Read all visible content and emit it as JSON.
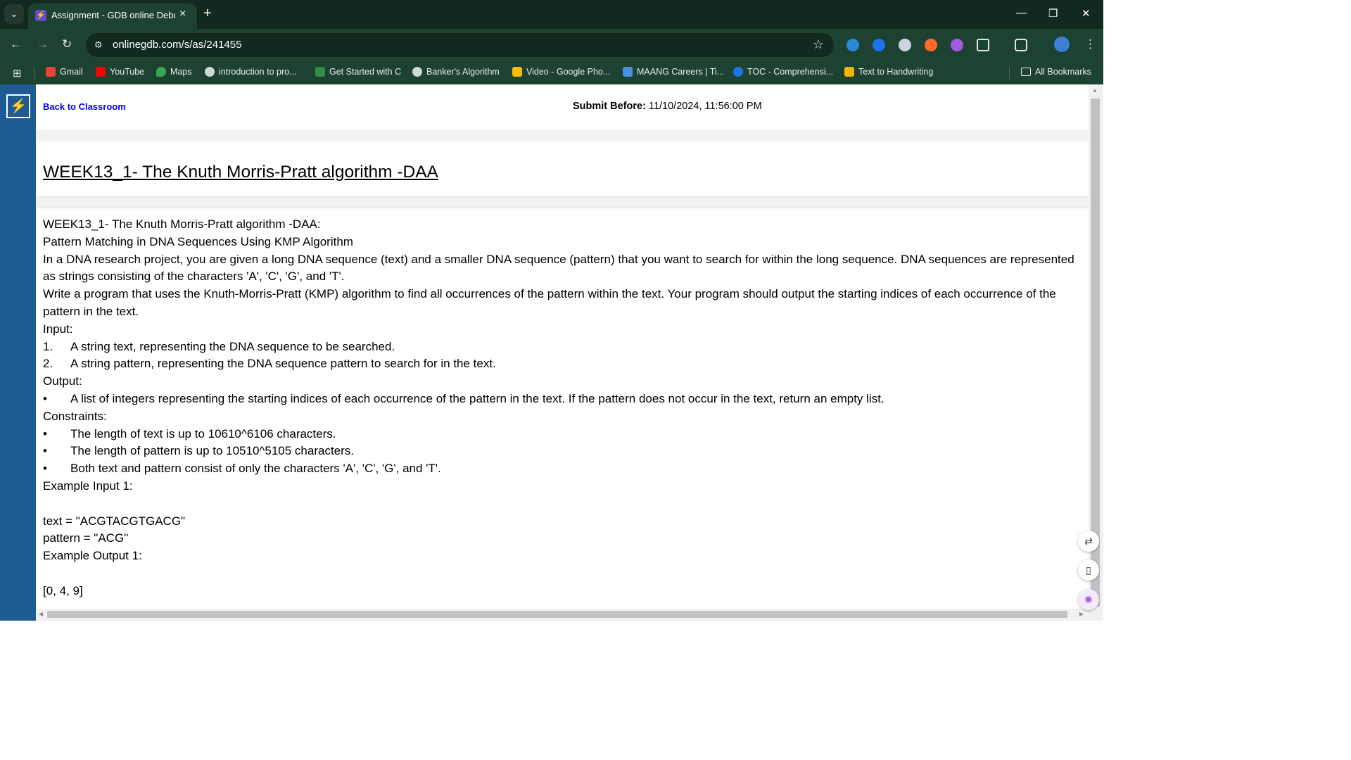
{
  "browser": {
    "tab_title": "Assignment - GDB online Debu",
    "url": "onlinegdb.com/s/as/241455",
    "bookmarks": [
      {
        "label": "Gmail",
        "color": "#ea4335"
      },
      {
        "label": "YouTube",
        "color": "#ff0000"
      },
      {
        "label": "Maps",
        "color": "#34a853"
      },
      {
        "label": "introduction to pro...",
        "color": "#cfd8d3"
      },
      {
        "label": "Get Started with C",
        "color": "#2f8d46"
      },
      {
        "label": "Banker's Algorithm",
        "color": "#cfd8d3"
      },
      {
        "label": "Video - Google Pho...",
        "color": "#fbbc05"
      },
      {
        "label": "MAANG Careers | Ti...",
        "color": "#4a90e2"
      },
      {
        "label": "TOC - Comprehensi...",
        "color": "#1a73e8"
      },
      {
        "label": "Text to Handwriting",
        "color": "#f5b400"
      }
    ],
    "all_bookmarks": "All Bookmarks"
  },
  "page": {
    "back_link": "Back to Classroom",
    "submit_label": "Submit Before:",
    "submit_value": "11/10/2024, 11:56:00 PM",
    "title": "WEEK13_1- The Knuth Morris-Pratt algorithm -DAA",
    "desc": {
      "l1": "WEEK13_1- The Knuth Morris-Pratt algorithm -DAA:",
      "l2": "Pattern Matching in DNA Sequences Using KMP Algorithm",
      "l3": "In a DNA research project, you are given a long DNA sequence (text) and a smaller DNA sequence (pattern) that you want to search for within the long sequence. DNA sequences are represented as strings consisting of the characters 'A', 'C', 'G', and 'T'.",
      "l4": "Write a program that uses the Knuth-Morris-Pratt (KMP) algorithm to find all occurrences of the pattern within the text. Your program should output the starting indices of each occurrence of the pattern in the text.",
      "input_h": "Input:",
      "input_items": [
        {
          "marker": "1.",
          "text": "A string text, representing the DNA sequence to be searched."
        },
        {
          "marker": "2.",
          "text": "A string pattern, representing the DNA sequence pattern to search for in the text."
        }
      ],
      "output_h": "Output:",
      "output_items": [
        {
          "marker": "•",
          "text": "A list of integers representing the starting indices of each occurrence of the pattern in the text. If the pattern does not occur in the text, return an empty list."
        }
      ],
      "constraints_h": "Constraints:",
      "constraint_items": [
        {
          "marker": "•",
          "text": "The length of text is up to 10610^6106 characters."
        },
        {
          "marker": "•",
          "text": "The length of pattern is up to 10510^5105 characters."
        },
        {
          "marker": "•",
          "text": "Both text and pattern consist of only the characters 'A', 'C', 'G', and 'T'."
        }
      ],
      "example_input_h": "Example Input 1:",
      "ex_text": "text = \"ACGTACGTGACG\"",
      "ex_pattern": "pattern = \"ACG\"",
      "example_output_h": "Example Output 1:",
      "ex_output": "[0, 4, 9]"
    }
  }
}
